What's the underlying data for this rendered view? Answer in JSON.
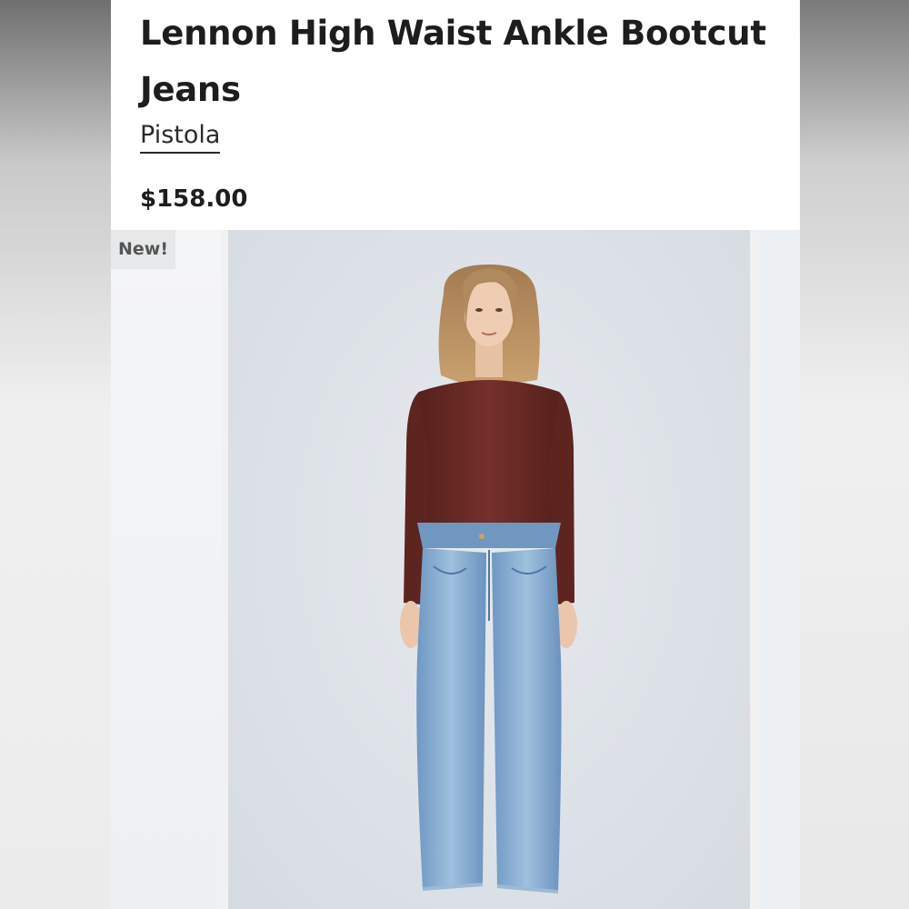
{
  "product": {
    "title": "Lennon High Waist Ankle Bootcut Jeans",
    "brand": "Pistola",
    "price": "$158.00",
    "badge": "New!"
  },
  "colors": {
    "title_text": "#1d1d1d",
    "badge_bg": "#e6e8ea",
    "top": "#6b2a24",
    "denim": "#7fa7cf",
    "photo_bg": "#dde2e8"
  }
}
